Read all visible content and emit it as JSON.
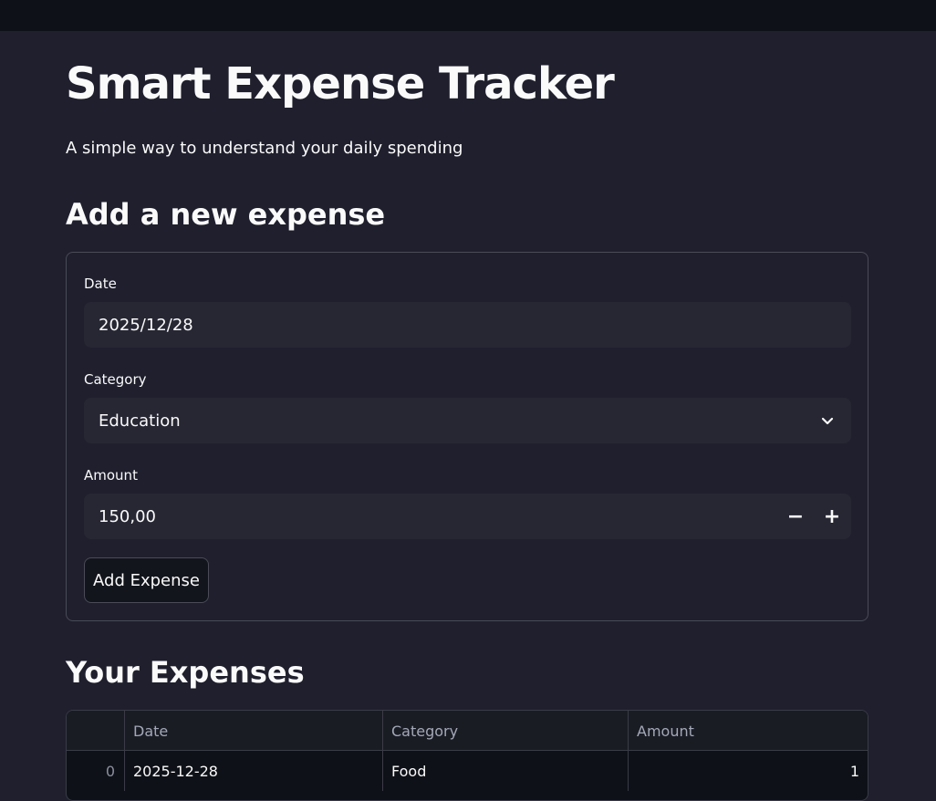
{
  "page": {
    "title": "Smart Expense Tracker",
    "subtitle": "A simple way to understand your daily spending"
  },
  "form": {
    "section_title": "Add a new expense",
    "date_label": "Date",
    "date_value": "2025/12/28",
    "category_label": "Category",
    "category_value": "Education",
    "amount_label": "Amount",
    "amount_value": "150,00",
    "minus_symbol": "−",
    "plus_symbol": "+",
    "submit_label": "Add Expense"
  },
  "expenses": {
    "section_title": "Your Expenses",
    "columns": [
      "",
      "Date",
      "Category",
      "Amount"
    ],
    "rows": [
      {
        "index": "0",
        "date": "2025-12-28",
        "category": "Food",
        "amount": "1"
      }
    ]
  },
  "colors": {
    "background": "#1f1f2e",
    "topbar": "#0e1117",
    "input_bg": "#272734",
    "border": "#4a4b57",
    "text": "#fafafa"
  }
}
